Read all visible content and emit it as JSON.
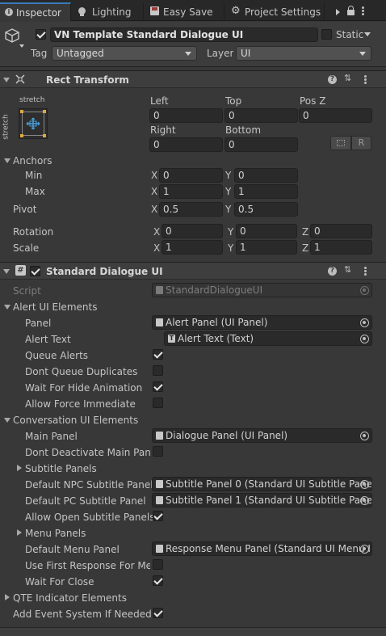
{
  "tabs": [
    {
      "label": "Inspector",
      "icon": "info-icon",
      "active": true
    },
    {
      "label": "Lighting",
      "icon": "lightbulb-icon",
      "active": false
    },
    {
      "label": "Easy Save",
      "icon": "floppy-icon",
      "active": false
    },
    {
      "label": "Project Settings",
      "icon": "gear-icon",
      "active": false
    }
  ],
  "gameobject": {
    "active": true,
    "name": "VN Template Standard Dialogue UI",
    "static_label": "Static",
    "static": false,
    "tag_label": "Tag",
    "tag_value": "Untagged",
    "layer_label": "Layer",
    "layer_value": "UI"
  },
  "rect_transform": {
    "title": "Rect Transform",
    "anchor_preset_top": "stretch",
    "anchor_preset_left": "stretch",
    "left_label": "Left",
    "left_value": "0",
    "top_label": "Top",
    "top_value": "0",
    "posz_label": "Pos Z",
    "posz_value": "0",
    "right_label": "Right",
    "right_value": "0",
    "bottom_label": "Bottom",
    "bottom_value": "0",
    "r_button": "R",
    "anchors_label": "Anchors",
    "min_label": "Min",
    "min_x": "0",
    "min_y": "0",
    "max_label": "Max",
    "max_x": "1",
    "max_y": "1",
    "pivot_label": "Pivot",
    "pivot_x": "0.5",
    "pivot_y": "0.5",
    "rotation_label": "Rotation",
    "rot_x": "0",
    "rot_y": "0",
    "rot_z": "0",
    "scale_label": "Scale",
    "scale_x": "1",
    "scale_y": "1",
    "scale_z": "1",
    "x": "X",
    "y": "Y",
    "z": "Z"
  },
  "dialogue_ui": {
    "title": "Standard Dialogue UI",
    "enabled": true,
    "script_label": "Script",
    "script_value": "StandardDialogueUI",
    "alert_header": "Alert UI Elements",
    "panel_label": "Panel",
    "panel_value": "Alert Panel (UI Panel)",
    "alert_text_label": "Alert Text",
    "alert_text_value": "Alert Text (Text)",
    "queue_alerts_label": "Queue Alerts",
    "queue_alerts": true,
    "dont_queue_label": "Dont Queue Duplicates",
    "dont_queue": false,
    "wait_hide_label": "Wait For Hide Animation",
    "wait_hide": true,
    "allow_force_label": "Allow Force Immediate",
    "allow_force": false,
    "conversation_header": "Conversation UI Elements",
    "main_panel_label": "Main Panel",
    "main_panel_value": "Dialogue Panel (UI Panel)",
    "dont_deactivate_label": "Dont Deactivate Main Pane",
    "dont_deactivate": false,
    "subtitle_panels_label": "Subtitle Panels",
    "default_npc_label": "Default NPC Subtitle Panel",
    "default_npc_value": "Subtitle Panel 0 (Standard UI Subtitle Pane",
    "default_pc_label": "Default PC Subtitle Panel",
    "default_pc_value": "Subtitle Panel 1 (Standard UI Subtitle Pane",
    "allow_open_label": "Allow Open Subtitle Panels",
    "allow_open": true,
    "menu_panels_label": "Menu Panels",
    "default_menu_label": "Default Menu Panel",
    "default_menu_value": "Response Menu Panel (Standard UI Menu I",
    "use_first_label": "Use First Response For Men",
    "use_first": false,
    "wait_close_label": "Wait For Close",
    "wait_close": true,
    "qte_header": "QTE Indicator Elements",
    "add_event_label": "Add Event System If Needed",
    "add_event": true
  }
}
